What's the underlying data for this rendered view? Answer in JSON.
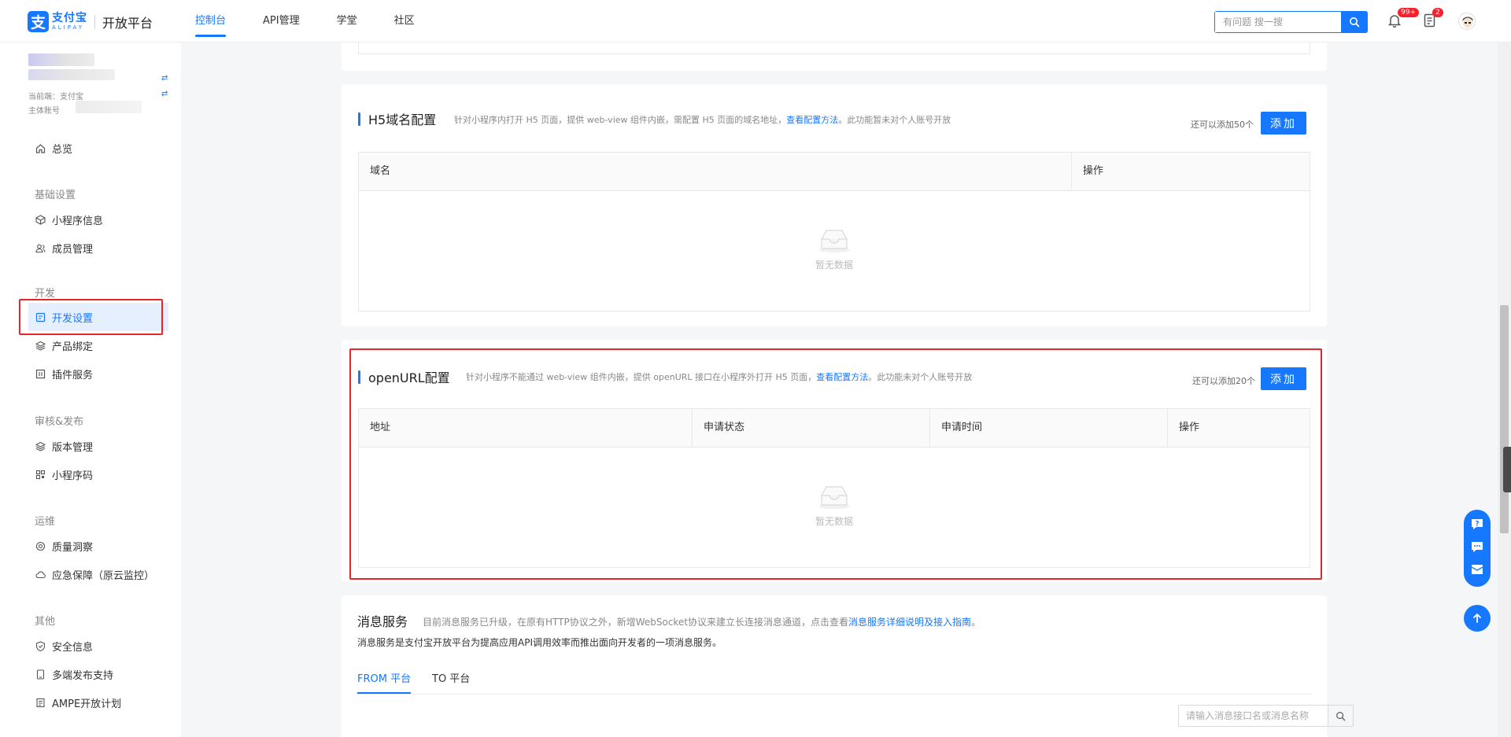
{
  "header": {
    "logo_cn": "支付宝",
    "logo_en": "ALIPAY",
    "platform": "开放平台",
    "nav": [
      {
        "label": "控制台",
        "active": true
      },
      {
        "label": "API管理",
        "active": false
      },
      {
        "label": "学堂",
        "active": false
      },
      {
        "label": "社区",
        "active": false
      }
    ],
    "search_placeholder": "有问题 搜一搜",
    "notice_badge": "99+",
    "todo_badge": "2"
  },
  "sidebar": {
    "current_end": "当前端：支付宝",
    "entity": "主体账号",
    "overview": "总览",
    "groups": {
      "basic": "基础设置",
      "dev": "开发",
      "review": "审核&发布",
      "ops": "运维",
      "other": "其他"
    },
    "items": {
      "mini_info": "小程序信息",
      "members": "成员管理",
      "dev_settings": "开发设置",
      "product_bind": "产品绑定",
      "plugin": "插件服务",
      "version": "版本管理",
      "qrcode": "小程序码",
      "quality": "质量洞察",
      "emergency": "应急保障（原云监控）",
      "security": "安全信息",
      "multi_end": "多端发布支持",
      "ampe": "AMPE开放计划"
    }
  },
  "h5": {
    "title": "H5域名配置",
    "desc_pre": "针对小程序内打开 H5 页面，提供 web-view 组件内嵌，需配置 H5 页面的域名地址，",
    "desc_link": "查看配置方法",
    "desc_post": "。此功能暂未对个人账号开放",
    "quota": "还可以添加50个",
    "add": "添加",
    "cols": [
      "域名",
      "操作"
    ],
    "empty": "暂无数据"
  },
  "openurl": {
    "title": "openURL配置",
    "desc_pre": "针对小程序不能通过 web-view 组件内嵌，提供 openURL 接口在小程序外打开 H5 页面，",
    "desc_link": "查看配置方法",
    "desc_post": "。此功能未对个人账号开放",
    "quota": "还可以添加20个",
    "add": "添加",
    "cols": [
      "地址",
      "申请状态",
      "申请时间",
      "操作"
    ],
    "empty": "暂无数据"
  },
  "msg": {
    "title": "消息服务",
    "desc_pre": "目前消息服务已升级，在原有HTTP协议之外，新增WebSocket协议来建立长连接消息通道，点击查看",
    "desc_link": "消息服务详细说明及接入指南",
    "desc_post": "。",
    "desc2": "消息服务是支付宝开放平台为提高应用API调用效率而推出面向开发者的一项消息服务。",
    "tabs": [
      "FROM 平台",
      "TO 平台"
    ],
    "search_placeholder": "请输入消息接口名或消息名称"
  }
}
